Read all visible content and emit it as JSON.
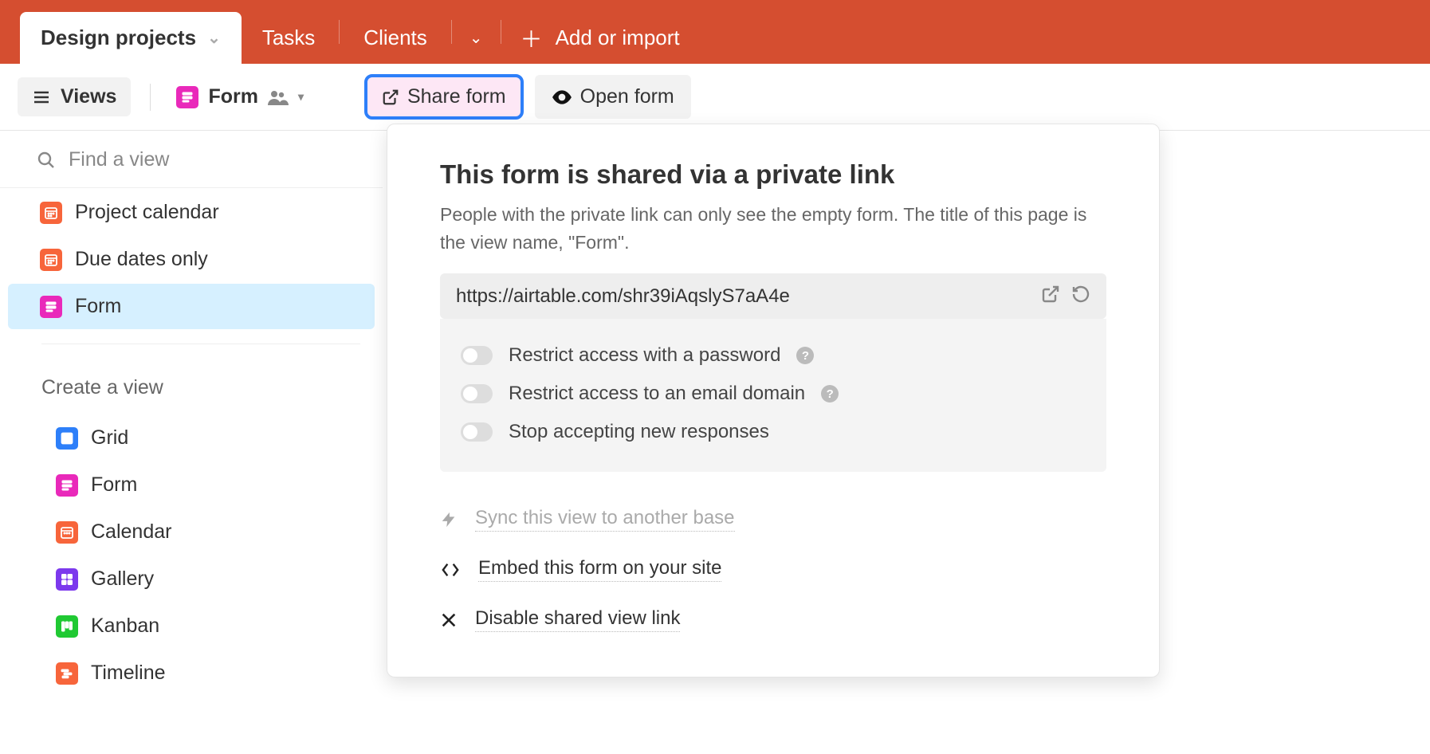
{
  "topbar": {
    "tabs": [
      {
        "label": "Design projects",
        "active": true
      },
      {
        "label": "Tasks"
      },
      {
        "label": "Clients"
      }
    ],
    "add_import": "Add or import"
  },
  "toolbar": {
    "views_label": "Views",
    "current_view": "Form",
    "share_label": "Share form",
    "open_label": "Open form"
  },
  "sidebar": {
    "search_placeholder": "Find a view",
    "views": [
      {
        "label": "Project calendar",
        "color": "orange"
      },
      {
        "label": "Due dates only",
        "color": "orange"
      },
      {
        "label": "Form",
        "color": "pink",
        "selected": true
      }
    ],
    "create_label": "Create a view",
    "create_options": [
      {
        "label": "Grid",
        "color": "blue"
      },
      {
        "label": "Form",
        "color": "pink"
      },
      {
        "label": "Calendar",
        "color": "orange"
      },
      {
        "label": "Gallery",
        "color": "purple"
      },
      {
        "label": "Kanban",
        "color": "green"
      },
      {
        "label": "Timeline",
        "color": "red"
      }
    ]
  },
  "popover": {
    "title": "This form is shared via a private link",
    "subtitle": "People with the private link can only see the empty form. The title of this page is the view name, \"Form\".",
    "url": "https://airtable.com/shr39iAqslyS7aA4e",
    "options": [
      {
        "label": "Restrict access with a password",
        "help": true
      },
      {
        "label": "Restrict access to an email domain",
        "help": true
      },
      {
        "label": "Stop accepting new responses",
        "help": false
      }
    ],
    "sync_label": "Sync this view to another base",
    "embed_label": "Embed this form on your site",
    "disable_label": "Disable shared view link"
  }
}
